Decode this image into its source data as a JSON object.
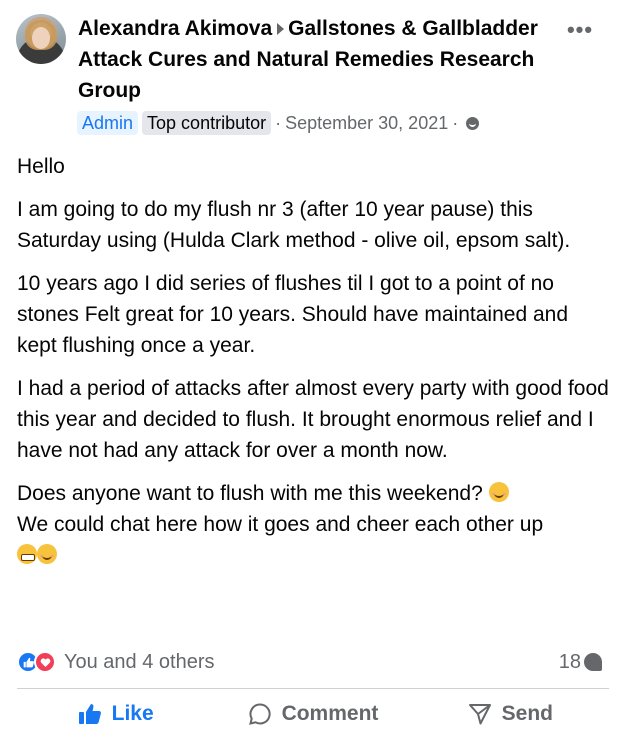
{
  "post": {
    "author": "Alexandra Akimova",
    "group": "Gallstones & Gallbladder Attack Cures and Natural Remedies Research Group",
    "badges": {
      "admin": "Admin",
      "top_contributor": "Top contributor"
    },
    "date": "September 30, 2021",
    "separator": "·",
    "paragraphs": [
      "Hello",
      "I am going to do my flush nr 3 (after 10 year pause) this Saturday using (Hulda Clark method - olive oil, epsom salt).",
      "10 years ago I did series of flushes til I got to a point of no stones Felt great for 10 years. Should have maintained and kept flushing once a year.",
      "I had a period of attacks after almost every party with good food this year and decided to flush. It brought enormous relief and I have not had any attack for over a month now."
    ],
    "last_paragraph_line1": "Does anyone want to flush with me this weekend?",
    "last_paragraph_line2": "We could chat here how it goes and cheer each other up",
    "more_label": "•••"
  },
  "reactions": {
    "summary": "You and 4 others",
    "comment_count": "18"
  },
  "actions": {
    "like": "Like",
    "comment": "Comment",
    "send": "Send"
  },
  "colors": {
    "accent": "#1877f2",
    "secondary_text": "#65676b",
    "love": "#f33e58"
  }
}
